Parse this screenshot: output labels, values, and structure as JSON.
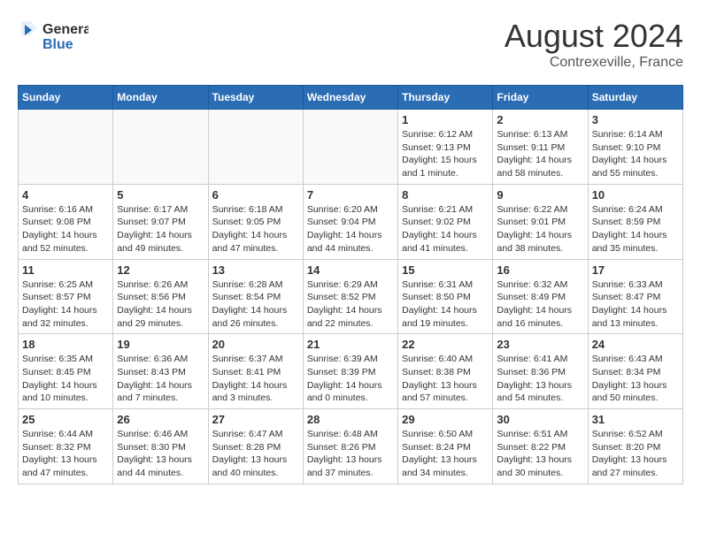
{
  "header": {
    "logo_general": "General",
    "logo_blue": "Blue",
    "month_year": "August 2024",
    "location": "Contrexeville, France"
  },
  "days_of_week": [
    "Sunday",
    "Monday",
    "Tuesday",
    "Wednesday",
    "Thursday",
    "Friday",
    "Saturday"
  ],
  "weeks": [
    [
      {
        "day": "",
        "info": ""
      },
      {
        "day": "",
        "info": ""
      },
      {
        "day": "",
        "info": ""
      },
      {
        "day": "",
        "info": ""
      },
      {
        "day": "1",
        "info": "Sunrise: 6:12 AM\nSunset: 9:13 PM\nDaylight: 15 hours\nand 1 minute."
      },
      {
        "day": "2",
        "info": "Sunrise: 6:13 AM\nSunset: 9:11 PM\nDaylight: 14 hours\nand 58 minutes."
      },
      {
        "day": "3",
        "info": "Sunrise: 6:14 AM\nSunset: 9:10 PM\nDaylight: 14 hours\nand 55 minutes."
      }
    ],
    [
      {
        "day": "4",
        "info": "Sunrise: 6:16 AM\nSunset: 9:08 PM\nDaylight: 14 hours\nand 52 minutes."
      },
      {
        "day": "5",
        "info": "Sunrise: 6:17 AM\nSunset: 9:07 PM\nDaylight: 14 hours\nand 49 minutes."
      },
      {
        "day": "6",
        "info": "Sunrise: 6:18 AM\nSunset: 9:05 PM\nDaylight: 14 hours\nand 47 minutes."
      },
      {
        "day": "7",
        "info": "Sunrise: 6:20 AM\nSunset: 9:04 PM\nDaylight: 14 hours\nand 44 minutes."
      },
      {
        "day": "8",
        "info": "Sunrise: 6:21 AM\nSunset: 9:02 PM\nDaylight: 14 hours\nand 41 minutes."
      },
      {
        "day": "9",
        "info": "Sunrise: 6:22 AM\nSunset: 9:01 PM\nDaylight: 14 hours\nand 38 minutes."
      },
      {
        "day": "10",
        "info": "Sunrise: 6:24 AM\nSunset: 8:59 PM\nDaylight: 14 hours\nand 35 minutes."
      }
    ],
    [
      {
        "day": "11",
        "info": "Sunrise: 6:25 AM\nSunset: 8:57 PM\nDaylight: 14 hours\nand 32 minutes."
      },
      {
        "day": "12",
        "info": "Sunrise: 6:26 AM\nSunset: 8:56 PM\nDaylight: 14 hours\nand 29 minutes."
      },
      {
        "day": "13",
        "info": "Sunrise: 6:28 AM\nSunset: 8:54 PM\nDaylight: 14 hours\nand 26 minutes."
      },
      {
        "day": "14",
        "info": "Sunrise: 6:29 AM\nSunset: 8:52 PM\nDaylight: 14 hours\nand 22 minutes."
      },
      {
        "day": "15",
        "info": "Sunrise: 6:31 AM\nSunset: 8:50 PM\nDaylight: 14 hours\nand 19 minutes."
      },
      {
        "day": "16",
        "info": "Sunrise: 6:32 AM\nSunset: 8:49 PM\nDaylight: 14 hours\nand 16 minutes."
      },
      {
        "day": "17",
        "info": "Sunrise: 6:33 AM\nSunset: 8:47 PM\nDaylight: 14 hours\nand 13 minutes."
      }
    ],
    [
      {
        "day": "18",
        "info": "Sunrise: 6:35 AM\nSunset: 8:45 PM\nDaylight: 14 hours\nand 10 minutes."
      },
      {
        "day": "19",
        "info": "Sunrise: 6:36 AM\nSunset: 8:43 PM\nDaylight: 14 hours\nand 7 minutes."
      },
      {
        "day": "20",
        "info": "Sunrise: 6:37 AM\nSunset: 8:41 PM\nDaylight: 14 hours\nand 3 minutes."
      },
      {
        "day": "21",
        "info": "Sunrise: 6:39 AM\nSunset: 8:39 PM\nDaylight: 14 hours\nand 0 minutes."
      },
      {
        "day": "22",
        "info": "Sunrise: 6:40 AM\nSunset: 8:38 PM\nDaylight: 13 hours\nand 57 minutes."
      },
      {
        "day": "23",
        "info": "Sunrise: 6:41 AM\nSunset: 8:36 PM\nDaylight: 13 hours\nand 54 minutes."
      },
      {
        "day": "24",
        "info": "Sunrise: 6:43 AM\nSunset: 8:34 PM\nDaylight: 13 hours\nand 50 minutes."
      }
    ],
    [
      {
        "day": "25",
        "info": "Sunrise: 6:44 AM\nSunset: 8:32 PM\nDaylight: 13 hours\nand 47 minutes."
      },
      {
        "day": "26",
        "info": "Sunrise: 6:46 AM\nSunset: 8:30 PM\nDaylight: 13 hours\nand 44 minutes."
      },
      {
        "day": "27",
        "info": "Sunrise: 6:47 AM\nSunset: 8:28 PM\nDaylight: 13 hours\nand 40 minutes."
      },
      {
        "day": "28",
        "info": "Sunrise: 6:48 AM\nSunset: 8:26 PM\nDaylight: 13 hours\nand 37 minutes."
      },
      {
        "day": "29",
        "info": "Sunrise: 6:50 AM\nSunset: 8:24 PM\nDaylight: 13 hours\nand 34 minutes."
      },
      {
        "day": "30",
        "info": "Sunrise: 6:51 AM\nSunset: 8:22 PM\nDaylight: 13 hours\nand 30 minutes."
      },
      {
        "day": "31",
        "info": "Sunrise: 6:52 AM\nSunset: 8:20 PM\nDaylight: 13 hours\nand 27 minutes."
      }
    ]
  ]
}
